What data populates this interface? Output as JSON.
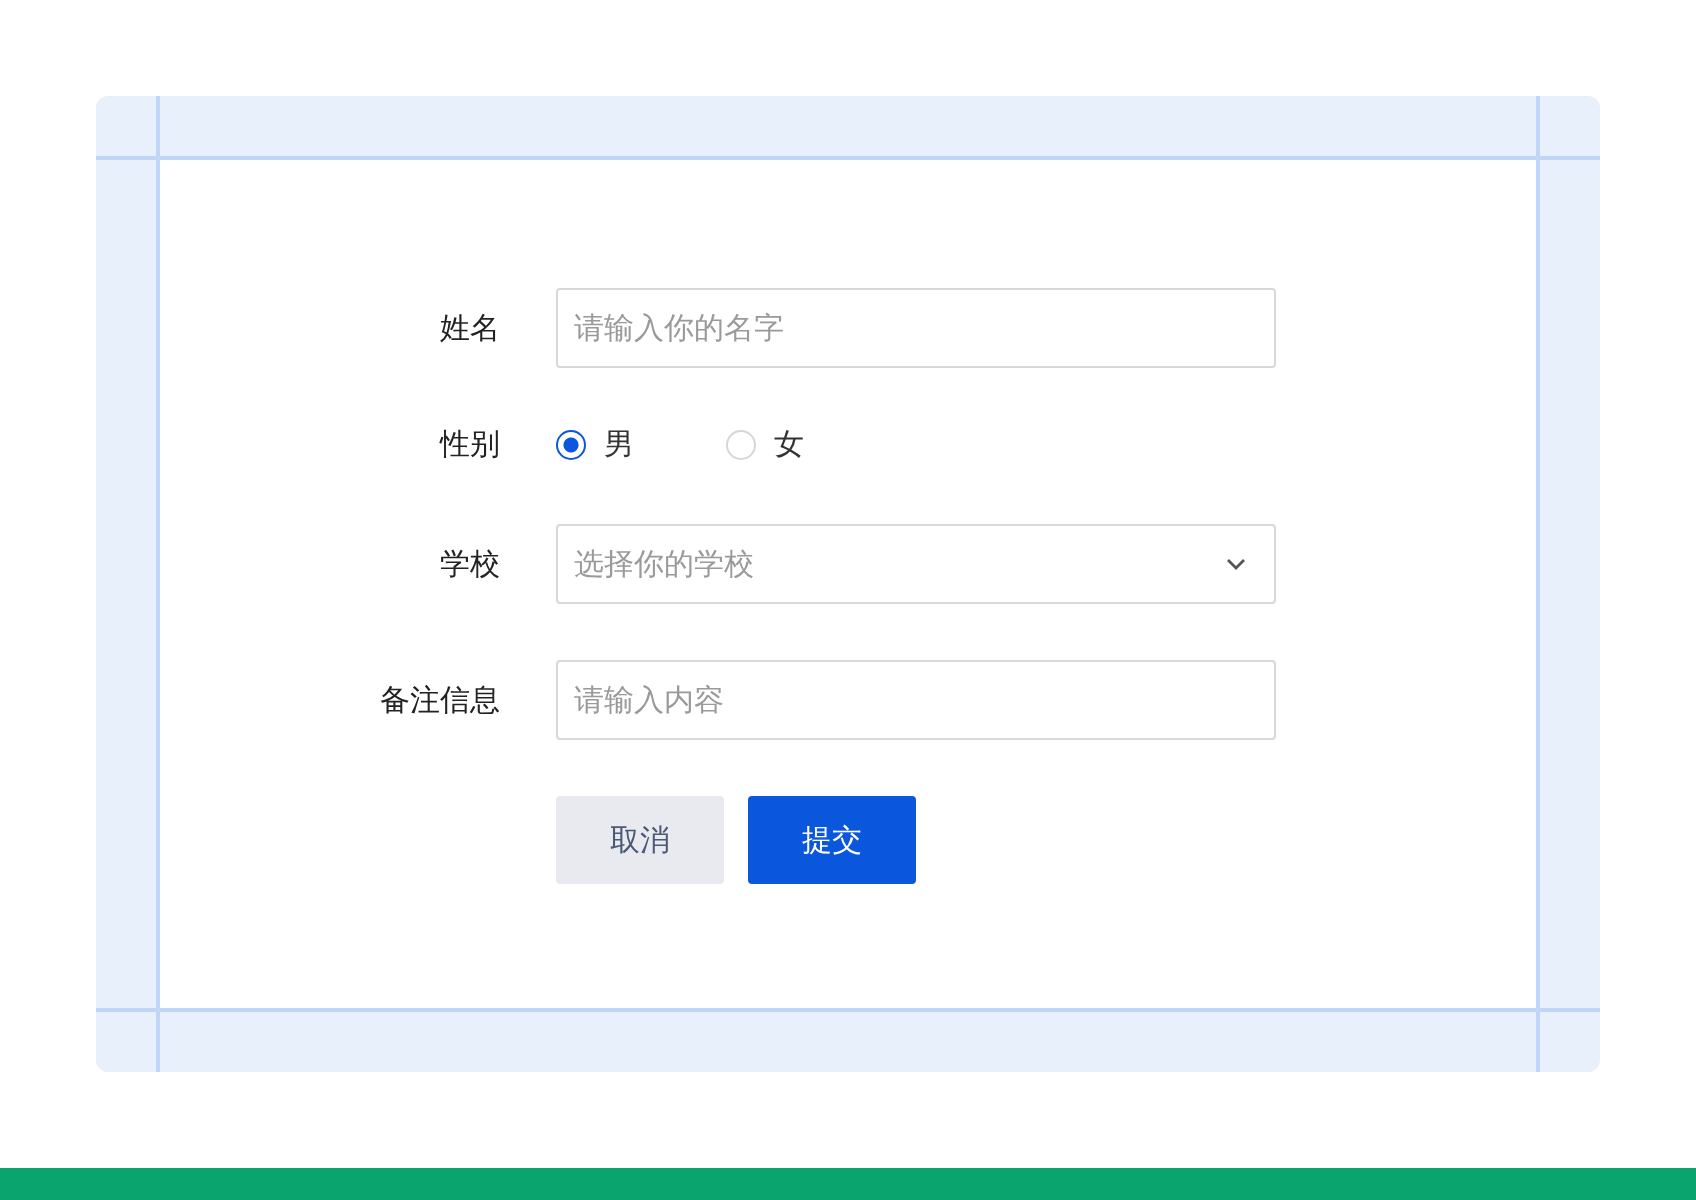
{
  "form": {
    "fields": [
      {
        "kind": "text",
        "label": "姓名",
        "placeholder": "请输入你的名字"
      },
      {
        "kind": "radio",
        "label": "性别",
        "options": [
          {
            "label": "男",
            "selected": true
          },
          {
            "label": "女",
            "selected": false
          }
        ]
      },
      {
        "kind": "select",
        "label": "学校",
        "placeholder": "选择你的学校"
      },
      {
        "kind": "text",
        "label": "备注信息",
        "placeholder": "请输入内容"
      }
    ],
    "buttons": [
      {
        "label": "取消",
        "kind": "secondary"
      },
      {
        "label": "提交",
        "kind": "primary"
      }
    ]
  }
}
